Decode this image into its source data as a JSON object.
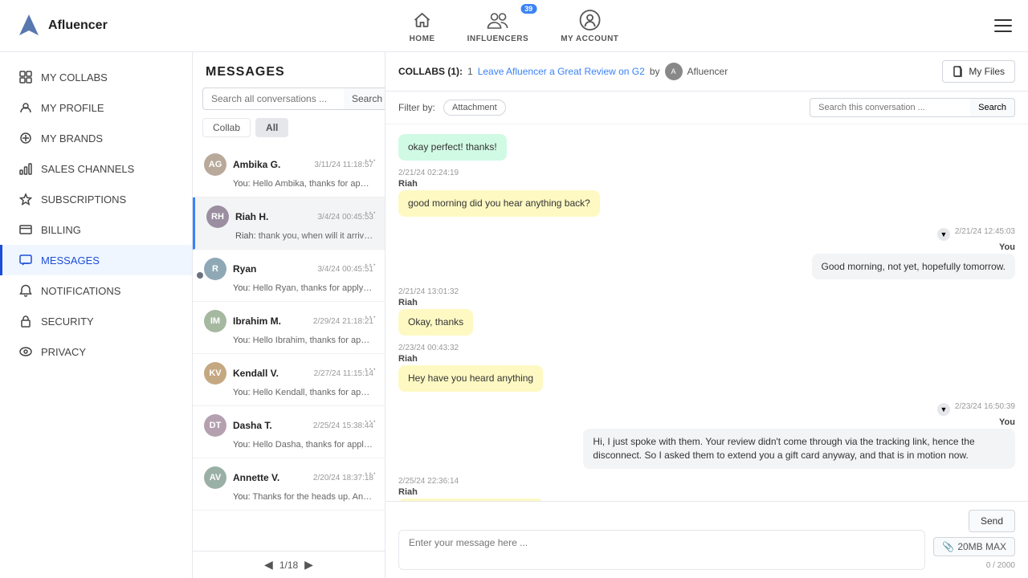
{
  "app": {
    "name": "Afluencer",
    "logo_alt": "Afluencer Logo"
  },
  "topnav": {
    "home_label": "HOME",
    "influencers_label": "INFLUENCERS",
    "my_account_label": "MY ACCOUNT",
    "badge_count": "39"
  },
  "sidebar": {
    "items": [
      {
        "id": "my-collabs",
        "label": "MY COLLABS",
        "icon": "⊞"
      },
      {
        "id": "my-profile",
        "label": "MY PROFILE",
        "icon": "👤"
      },
      {
        "id": "my-brands",
        "label": "MY BRANDS",
        "icon": "🏷"
      },
      {
        "id": "sales-channels",
        "label": "SALES CHANNELS",
        "icon": "📊"
      },
      {
        "id": "subscriptions",
        "label": "SUBSCRIPTIONS",
        "icon": "⭐"
      },
      {
        "id": "billing",
        "label": "BILLING",
        "icon": "🧾"
      },
      {
        "id": "messages",
        "label": "MESSAGES",
        "icon": "✉"
      },
      {
        "id": "notifications",
        "label": "NOTIFICATIONS",
        "icon": "🔔"
      },
      {
        "id": "security",
        "label": "SECURITY",
        "icon": "🔒"
      },
      {
        "id": "privacy",
        "label": "PRIVACY",
        "icon": "👁"
      }
    ]
  },
  "messages_panel": {
    "title": "MESSAGES",
    "search_placeholder": "Search all conversations ...",
    "search_button": "Search",
    "filter_tabs": [
      {
        "label": "Collab",
        "active": false
      },
      {
        "label": "All",
        "active": true
      }
    ],
    "conversations": [
      {
        "name": "Ambika G.",
        "time": "3/11/24 11:18:57",
        "preview_label": "You:",
        "preview": "Hello Ambika, thanks for applying to Leave Afluencer a Gre...",
        "initials": "AG",
        "color": "#b8a99a",
        "unread": false
      },
      {
        "name": "Riah H.",
        "time": "3/4/24 00:45:53",
        "preview_label": "Riah:",
        "preview": "thank you, when will it arrive?",
        "initials": "RH",
        "color": "#9b8ea0",
        "unread": false,
        "selected": true
      },
      {
        "name": "Ryan",
        "time": "3/4/24 00:45:51",
        "preview_label": "You:",
        "preview": "Hello Ryan, thanks for applying to Leave Afluencer a Great ...",
        "initials": "R",
        "color": "#8fa8b5",
        "unread": true
      },
      {
        "name": "Ibrahim M.",
        "time": "2/29/24 21:18:21",
        "preview_label": "You:",
        "preview": "Hello Ibrahim, thanks for applying to Leave Afluencer a Gre...",
        "initials": "IM",
        "color": "#a5b8a0",
        "unread": false
      },
      {
        "name": "Kendall V.",
        "time": "2/27/24 11:15:14",
        "preview_label": "You:",
        "preview": "Hello Kendall, thanks for applying to Leave Afluencer a Gre...",
        "initials": "KV",
        "color": "#c4a882",
        "unread": false
      },
      {
        "name": "Dasha T.",
        "time": "2/25/24 15:38:44",
        "preview_label": "You:",
        "preview": "Hello Dasha, thanks for applying to Leave Afluencer a Grea...",
        "initials": "DT",
        "color": "#b5a0b0",
        "unread": false
      },
      {
        "name": "Annette V.",
        "time": "2/20/24 18:37:18",
        "preview_label": "You:",
        "preview": "Thanks for the heads up. Annette. Can you please send me...",
        "initials": "AV",
        "color": "#9ab0a5",
        "unread": false
      }
    ],
    "pagination": {
      "current": "1/18"
    }
  },
  "chat": {
    "collabs_label": "COLLABS (1):",
    "collabs_count": "1",
    "collab_link": "Leave Afluencer a Great Review on G2",
    "collab_by": "by",
    "collab_user": "Afluencer",
    "my_files_button": "My Files",
    "filter_label": "Filter by:",
    "filter_chip": "Attachment",
    "conv_search_placeholder": "Search this conversation ...",
    "conv_search_button": "Search",
    "messages": [
      {
        "id": 1,
        "type": "right-simple",
        "text": "okay perfect! thanks!",
        "bubble": "green-simple"
      },
      {
        "id": 2,
        "type": "left",
        "time": "2/21/24 02:24:19",
        "sender": "Riah",
        "text": "good morning did you hear anything back?",
        "bubble": "yellow"
      },
      {
        "id": 3,
        "type": "right",
        "time": "2/21/24 12:45:03",
        "sender_label": "You",
        "text": "Good morning, not yet, hopefully tomorrow.",
        "bubble": "gray-right"
      },
      {
        "id": 4,
        "type": "left",
        "time": "2/21/24 13:01:32",
        "sender": "Riah",
        "text": "Okay, thanks",
        "bubble": "yellow"
      },
      {
        "id": 5,
        "type": "left",
        "time": "2/23/24 00:43:32",
        "sender": "Riah",
        "text": "Hey have you heard anything",
        "bubble": "yellow"
      },
      {
        "id": 6,
        "type": "right",
        "time": "2/23/24 16:50:39",
        "sender_label": "You",
        "text": "Hi, I just spoke with them. Your review didn't come through via the tracking link, hence the disconnect. So I asked them to extend you a gift card anyway, and that is in motion now.",
        "bubble": "gray-right"
      },
      {
        "id": 7,
        "type": "left",
        "time": "2/25/24 22:36:14",
        "sender": "Riah",
        "text": "thank you, when will it arrive?",
        "bubble": "yellow"
      }
    ],
    "input_placeholder": "Enter your message here ...",
    "send_button": "Send",
    "attach_icon": "📎",
    "attach_label": "20MB MAX",
    "char_count": "0 / 2000"
  }
}
